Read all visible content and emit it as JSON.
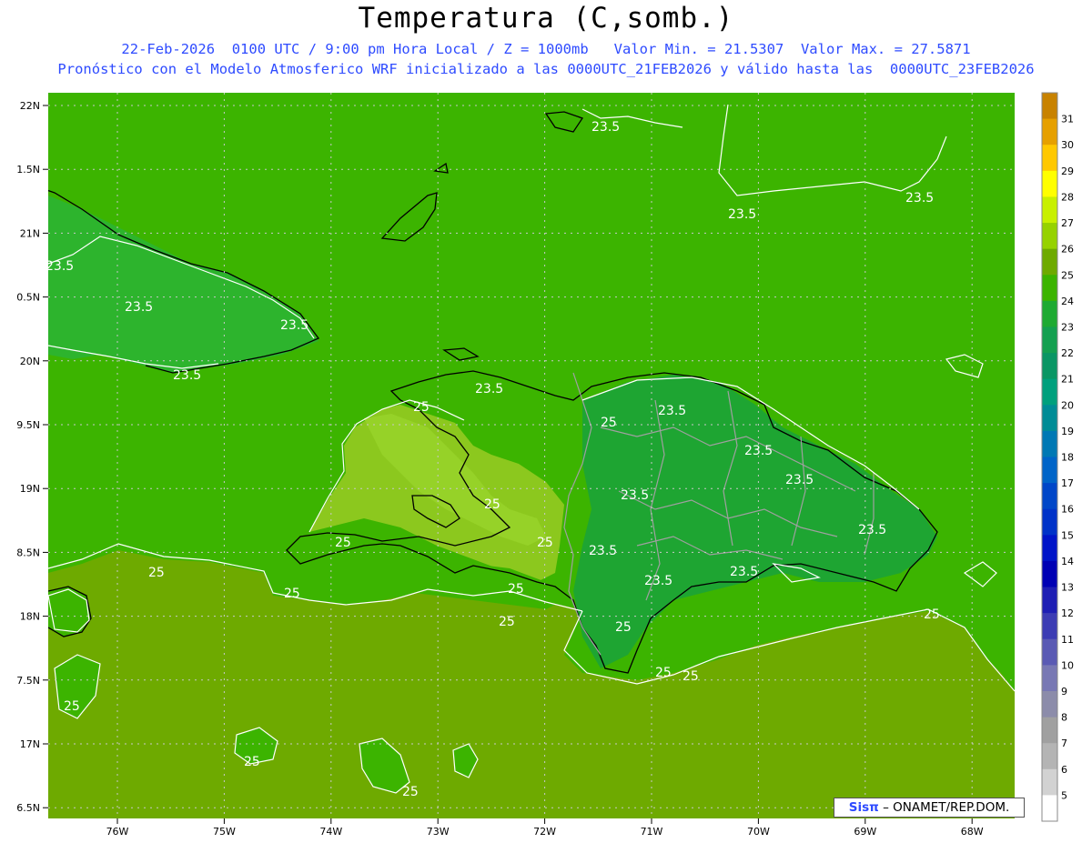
{
  "title": "Temperatura (C,somb.)",
  "subtitle_line1": "22-Feb-2026  0100 UTC / 9:00 pm Hora Local / Z = 1000mb   Valor Min. = 21.5307  Valor Max. = 27.5871",
  "subtitle_line2": "Pronóstico con el Modelo Atmosferico WRF inicializado a las 0000UTC_21FEB2026 y válido hasta las  0000UTC_23FEB2026",
  "credit": {
    "brand": "Sisπ",
    "text": " – ONAMET/REP.DOM."
  },
  "x_ticks": [
    "76W",
    "75W",
    "74W",
    "73W",
    "72W",
    "71W",
    "70W",
    "69W",
    "68W"
  ],
  "y_ticks": [
    "22N",
    "1.5N",
    "21N",
    "0.5N",
    "20N",
    "9.5N",
    "19N",
    "8.5N",
    "18N",
    "7.5N",
    "17N",
    "6.5N"
  ],
  "colorbar": {
    "labels": [
      "31",
      "30",
      "29",
      "28",
      "27",
      "26",
      "25",
      "24",
      "23",
      "22",
      "21",
      "20",
      "19",
      "18",
      "17",
      "16",
      "15",
      "14",
      "13",
      "12",
      "11",
      "10",
      "9",
      "8",
      "7",
      "6",
      "5"
    ],
    "colors": [
      "#c88200",
      "#e6a000",
      "#ffc800",
      "#ffff00",
      "#c8f000",
      "#96d200",
      "#6eaa00",
      "#3cb400",
      "#1eaa32",
      "#14a050",
      "#0a9664",
      "#00a07d",
      "#008c96",
      "#0078b4",
      "#0064c8",
      "#0046c8",
      "#0032c8",
      "#0014c8",
      "#0000b4",
      "#1e1eb4",
      "#3c3cb4",
      "#5a5ab4",
      "#7878b4",
      "#8c8caa",
      "#a0a0a0",
      "#b4b4b4",
      "#d2d2d2",
      "#ffffff"
    ]
  },
  "colors": {
    "sea": "#6eaa00",
    "land_warm": "#96c81e",
    "land_mid": "#3cb400",
    "land_cool": "#1eaa32",
    "gulf": "#8cd21e",
    "contour": "#ffffff"
  },
  "contour_labels": [
    "23.5",
    "23.5",
    "23.5",
    "23.5",
    "23.5",
    "23.5",
    "23.5",
    "23.5",
    "23.5",
    "23.5",
    "23.5",
    "23.5",
    "23.5",
    "23.5",
    "23.5",
    "23.5",
    "25",
    "25",
    "25",
    "25",
    "25",
    "25",
    "25",
    "25",
    "25",
    "25",
    "25",
    "25",
    "25",
    "25",
    "25",
    "25"
  ]
}
